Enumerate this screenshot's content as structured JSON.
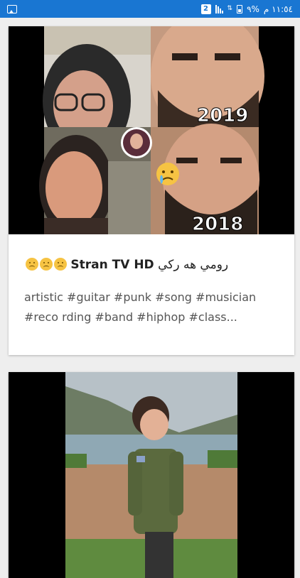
{
  "status_bar": {
    "time": "١١:٥٤ م",
    "battery": "%٩",
    "notification_count": "2",
    "background_color": "#1976d2"
  },
  "feed": [
    {
      "title_ar": "رومي هه ركي",
      "title_en": "Stran TV HD",
      "emojis": [
        "sad-face-emoji",
        "sad-face-emoji",
        "sad-face-emoji"
      ],
      "overlay_year_top": "2019",
      "overlay_year_bottom": "2018",
      "description": "artistic #guitar #punk #song #musician #reco rding #band #hiphop #class..."
    },
    {
      "thumbnail": "child-in-jacket-by-lake"
    }
  ]
}
